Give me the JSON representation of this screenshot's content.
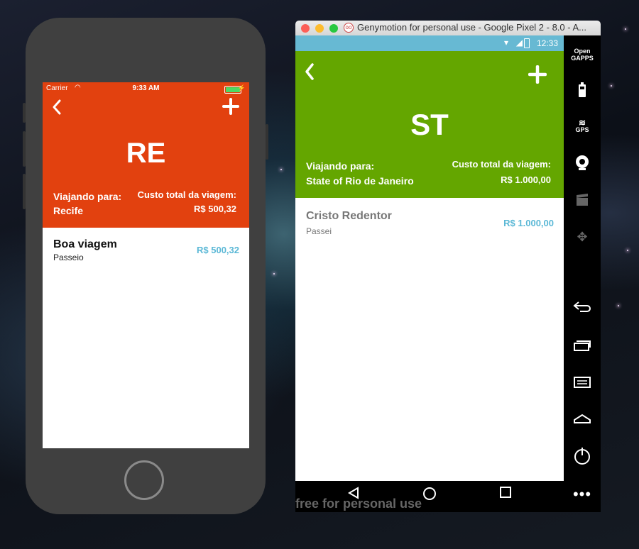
{
  "ios": {
    "status": {
      "carrier": "Carrier",
      "time": "9:33 AM"
    },
    "code": "RE",
    "travel_label": "Viajando para:",
    "city": "Recife",
    "cost_label": "Custo total da viagem:",
    "cost_value": "R$ 500,32",
    "items": [
      {
        "title": "Boa viagem",
        "subtitle": "Passeio",
        "price": "R$ 500,32"
      }
    ],
    "header_color": "#e2410f"
  },
  "android": {
    "window_title": "Genymotion for personal use - Google Pixel 2 - 8.0 - A...",
    "status": {
      "time": "12:33"
    },
    "code": "ST",
    "travel_label": "Viajando para:",
    "city": "State of Rio de Janeiro",
    "cost_label": "Custo total da viagem:",
    "cost_value": "R$ 1.000,00",
    "items": [
      {
        "title": "Cristo Redentor",
        "subtitle": "Passei",
        "price": "R$ 1.000,00"
      }
    ],
    "header_color": "#64a600",
    "watermark": "free for personal use"
  },
  "toolbar": {
    "opengapps_label": "Open GAPPS",
    "gps_label": "GPS",
    "icons": [
      "opengapps-icon",
      "battery-icon",
      "gps-icon",
      "webcam-icon",
      "video-capture-icon",
      "dpad-icon",
      "back-icon",
      "recent-apps-icon",
      "menu-icon",
      "home-icon",
      "power-icon",
      "more-icon"
    ]
  }
}
